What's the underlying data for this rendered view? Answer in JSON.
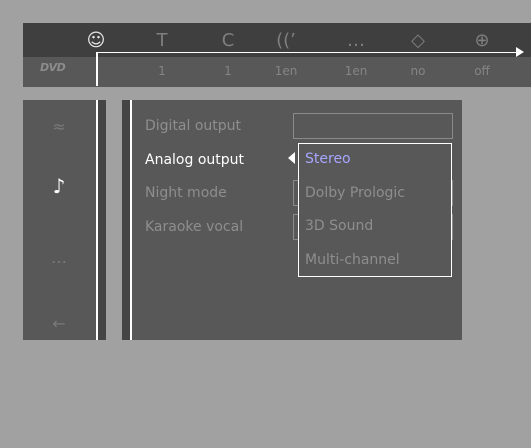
{
  "top_bar": {
    "logo": "DVD",
    "icons": [
      {
        "name": "disc-menu-icon",
        "glyph": "☺",
        "active": true
      },
      {
        "name": "title-icon",
        "glyph": "T",
        "active": false
      },
      {
        "name": "chapter-icon",
        "glyph": "C",
        "active": false
      },
      {
        "name": "audio-icon",
        "glyph": "((’",
        "active": false
      },
      {
        "name": "subtitle-icon",
        "glyph": "…",
        "active": false
      },
      {
        "name": "angle-icon",
        "glyph": "◇",
        "active": false
      },
      {
        "name": "zoom-icon",
        "glyph": "⊕",
        "active": false
      }
    ],
    "values": [
      "1",
      "1",
      "1en",
      "1en",
      "no",
      "off"
    ]
  },
  "sidebar": {
    "items": [
      {
        "name": "picture-settings-icon",
        "glyph": "≈",
        "active": false
      },
      {
        "name": "sound-settings-icon",
        "glyph": "♪",
        "active": true
      },
      {
        "name": "language-settings-icon",
        "glyph": "…",
        "active": false
      },
      {
        "name": "features-settings-icon",
        "glyph": "←",
        "active": false
      }
    ]
  },
  "menu": {
    "items": [
      {
        "label": "Digital output",
        "selected": false
      },
      {
        "label": "Analog output",
        "selected": true
      },
      {
        "label": "Night mode",
        "selected": false
      },
      {
        "label": "Karaoke vocal",
        "selected": false
      }
    ]
  },
  "dropdown": {
    "options": [
      "Stereo",
      "Dolby Prologic",
      "3D Sound",
      "Multi-channel"
    ],
    "highlighted": "Stereo"
  },
  "colors": {
    "background": "#a1a1a1",
    "panel": "#585858",
    "panel_dark": "#3f3f3f",
    "text_dim": "#8e8e8e",
    "text_active": "#ffffff",
    "option_highlight": "#a6a6ff"
  }
}
